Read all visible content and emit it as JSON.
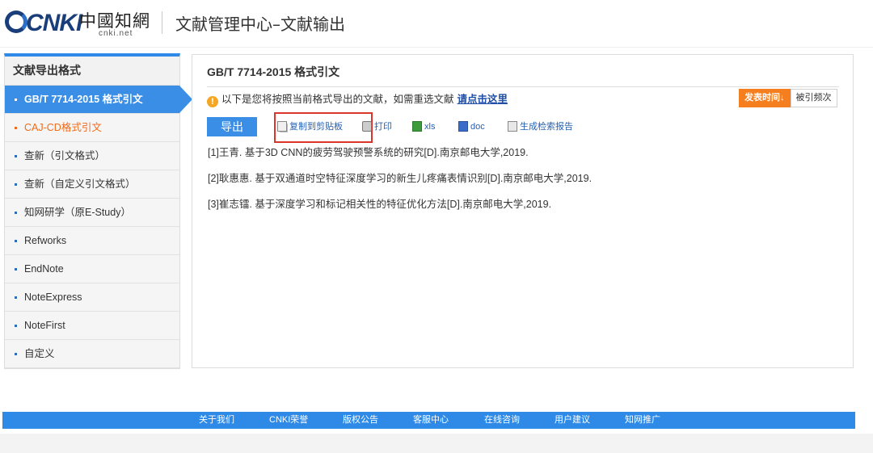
{
  "header": {
    "logo_cnki": "CNKI",
    "logo_cn": "中國知網",
    "logo_net": "cnki.net",
    "title": "文献管理中心–文献输出"
  },
  "sidebar": {
    "heading": "文献导出格式",
    "items": [
      {
        "label": "GB/T 7714-2015 格式引文",
        "state": "active"
      },
      {
        "label": "CAJ-CD格式引文",
        "state": "highlighted"
      },
      {
        "label": "查新（引文格式）"
      },
      {
        "label": "查新（自定义引文格式）"
      },
      {
        "label": "知网研学（原E-Study）"
      },
      {
        "label": "Refworks"
      },
      {
        "label": "EndNote"
      },
      {
        "label": "NoteExpress"
      },
      {
        "label": "NoteFirst"
      },
      {
        "label": "自定义"
      }
    ]
  },
  "main": {
    "title": "GB/T 7714-2015 格式引文",
    "notice_text": "以下是您将按照当前格式导出的文献，如需重选文献",
    "notice_link": "请点击这里",
    "sort": {
      "publish_time": "发表时间",
      "publish_time_arrow": "↓",
      "cited_count": "被引频次"
    },
    "toolbar": {
      "export": "导出",
      "copy": "复制到剪贴板",
      "print": "打印",
      "xls": "xls",
      "doc": "doc",
      "report": "生成检索报告"
    },
    "references": [
      "[1]王青. 基于3D CNN的疲劳驾驶预警系统的研究[D].南京邮电大学,2019.",
      "[2]耿惠惠. 基于双通道时空特征深度学习的新生儿疼痛表情识别[D].南京邮电大学,2019.",
      "[3]崔志镭. 基于深度学习和标记相关性的特征优化方法[D].南京邮电大学,2019."
    ]
  },
  "footer": {
    "links": [
      "关于我们",
      "CNKI荣誉",
      "版权公告",
      "客服中心",
      "在线咨询",
      "用户建议",
      "知网推广"
    ]
  },
  "colors": {
    "accent_blue": "#3a8ee6",
    "orange": "#f57f1f",
    "highlight_red": "#d9352b",
    "link_blue": "#1f4ea6"
  }
}
